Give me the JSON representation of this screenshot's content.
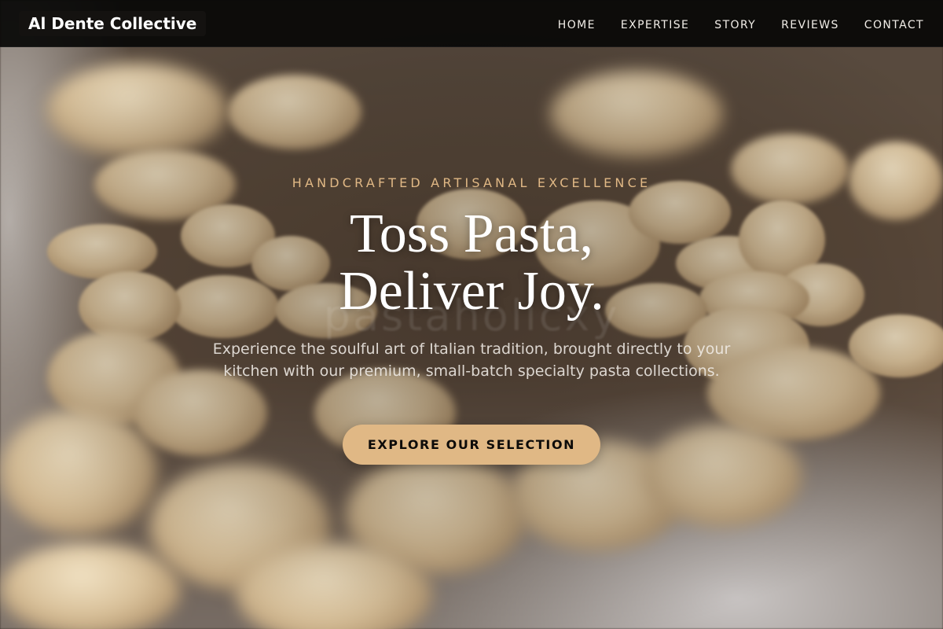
{
  "navbar": {
    "brand": "Al Dente Collective",
    "links": [
      {
        "label": "HOME"
      },
      {
        "label": "EXPERTISE"
      },
      {
        "label": "STORY"
      },
      {
        "label": "REVIEWS"
      },
      {
        "label": "CONTACT"
      }
    ]
  },
  "hero": {
    "eyebrow": "HANDCRAFTED ARTISANAL EXCELLENCE",
    "headline_line1": "Toss Pasta,",
    "headline_line2": "Deliver Joy.",
    "watermark": "pastaholicxy",
    "subtext": "Experience the soulful art of Italian tradition, brought directly to your kitchen with our premium, small-batch specialty pasta collections.",
    "cta_label": "EXPLORE OUR SELECTION",
    "background_icon": "blurred-pasta-photo"
  },
  "colors": {
    "accent": "#e0b885",
    "navbar_bg": "#080706",
    "headline": "#ffffff",
    "cta_text": "#0d0b09"
  }
}
